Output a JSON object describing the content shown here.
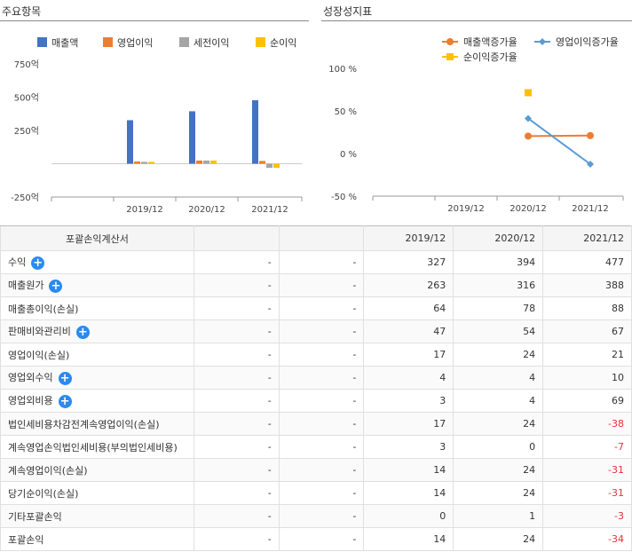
{
  "left_title": "주요항목",
  "right_title": "성장성지표",
  "chart_data": [
    {
      "type": "bar",
      "categories": [
        "2019/12",
        "2020/12",
        "2021/12"
      ],
      "series": [
        {
          "name": "매출액",
          "color": "#4472c4",
          "values": [
            327,
            394,
            477
          ]
        },
        {
          "name": "영업이익",
          "color": "#ed7d31",
          "values": [
            17,
            24,
            21
          ]
        },
        {
          "name": "세전이익",
          "color": "#a5a5a5",
          "values": [
            14,
            24,
            -31
          ]
        },
        {
          "name": "순이익",
          "color": "#ffc000",
          "values": [
            14,
            24,
            -31
          ]
        }
      ],
      "yticks": [
        "750억",
        "500억",
        "250억",
        "-250억"
      ],
      "ylim": [
        -250,
        750
      ]
    },
    {
      "type": "line",
      "categories": [
        "2019/12",
        "2020/12",
        "2021/12"
      ],
      "series": [
        {
          "name": "매출액증가율",
          "color": "#ed7d31",
          "marker": "circle",
          "values": [
            null,
            20.5,
            21.1
          ]
        },
        {
          "name": "영업이익증가율",
          "color": "#5b9bd5",
          "marker": "diamond",
          "values": [
            null,
            41.2,
            -12.5
          ]
        },
        {
          "name": "순이익증가율",
          "color": "#ffc000",
          "marker": "square",
          "values": [
            null,
            71.4,
            null
          ]
        }
      ],
      "yticks": [
        "100 %",
        "50 %",
        "0 %",
        "-50 %"
      ],
      "ylim": [
        -50,
        100
      ]
    }
  ],
  "table": {
    "header": [
      "포괄손익계산서",
      "",
      "",
      "2019/12",
      "2020/12",
      "2021/12"
    ],
    "rows": [
      {
        "label": "수익",
        "plus": true,
        "c1": "-",
        "c2": "-",
        "v": [
          "327",
          "394",
          "477"
        ]
      },
      {
        "label": "매출원가",
        "plus": true,
        "c1": "-",
        "c2": "-",
        "v": [
          "263",
          "316",
          "388"
        ]
      },
      {
        "label": "매출총이익(손실)",
        "plus": false,
        "c1": "-",
        "c2": "-",
        "v": [
          "64",
          "78",
          "88"
        ]
      },
      {
        "label": "판매비와관리비",
        "plus": true,
        "c1": "-",
        "c2": "-",
        "v": [
          "47",
          "54",
          "67"
        ]
      },
      {
        "label": "영업이익(손실)",
        "plus": false,
        "c1": "-",
        "c2": "-",
        "v": [
          "17",
          "24",
          "21"
        ]
      },
      {
        "label": "영업외수익",
        "plus": true,
        "c1": "-",
        "c2": "-",
        "v": [
          "4",
          "4",
          "10"
        ]
      },
      {
        "label": "영업외비용",
        "plus": true,
        "c1": "-",
        "c2": "-",
        "v": [
          "3",
          "4",
          "69"
        ]
      },
      {
        "label": "법인세비용차감전계속영업이익(손실)",
        "plus": false,
        "c1": "-",
        "c2": "-",
        "v": [
          "17",
          "24",
          "-38"
        ]
      },
      {
        "label": "계속영업손익법인세비용(부의법인세비용)",
        "plus": false,
        "c1": "-",
        "c2": "-",
        "v": [
          "3",
          "0",
          "-7"
        ]
      },
      {
        "label": "계속영업이익(손실)",
        "plus": false,
        "c1": "-",
        "c2": "-",
        "v": [
          "14",
          "24",
          "-31"
        ]
      },
      {
        "label": "당기순이익(손실)",
        "plus": false,
        "c1": "-",
        "c2": "-",
        "v": [
          "14",
          "24",
          "-31"
        ]
      },
      {
        "label": "기타포괄손익",
        "plus": false,
        "c1": "-",
        "c2": "-",
        "v": [
          "0",
          "1",
          "-3"
        ]
      },
      {
        "label": "포괄손익",
        "plus": false,
        "c1": "-",
        "c2": "-",
        "v": [
          "14",
          "24",
          "-34"
        ]
      }
    ]
  }
}
